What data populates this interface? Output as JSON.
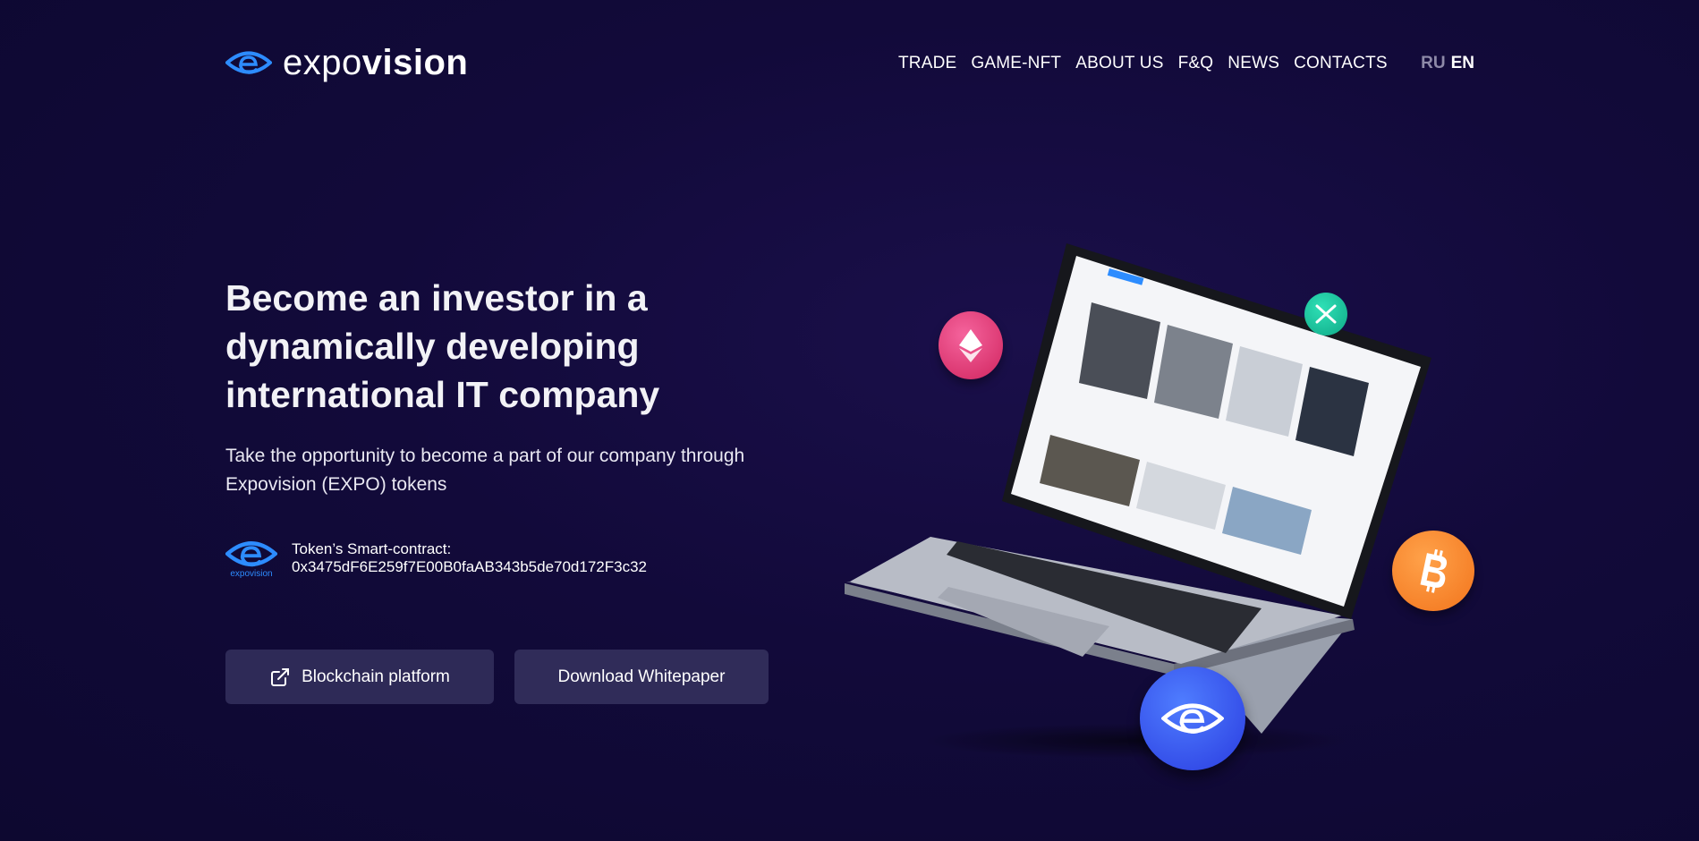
{
  "brand": {
    "name_part1": "expo",
    "name_part2": "vision",
    "small_logo_text": "expovision"
  },
  "nav": {
    "items": [
      {
        "label": "TRADE"
      },
      {
        "label": "GAME-NFT"
      },
      {
        "label": "ABOUT US"
      },
      {
        "label": "F&Q"
      },
      {
        "label": "NEWS"
      },
      {
        "label": "CONTACTS"
      }
    ],
    "lang_ru": "RU",
    "lang_en": "EN"
  },
  "hero": {
    "title": "Become an investor in a dynamically developing international IT company",
    "subtitle": "Take the opportunity to become a part of our company through Expovision (EXPO) tokens",
    "contract_label": "Token’s Smart-contract:",
    "contract_address": "0x3475dF6E259f7E00B0faAB343b5de70d172F3c32"
  },
  "buttons": {
    "blockchain_label": "Blockchain platform",
    "whitepaper_label": "Download Whitepaper"
  },
  "colors": {
    "background": "#120a3a",
    "button": "#2e2a57",
    "brand_blue": "#2d8cff",
    "eth_coin": "#e0336f",
    "xrp_coin": "#1cc79c",
    "btc_coin": "#f7841f",
    "expo_coin": "#3b53f0"
  },
  "icons": {
    "external_link": "external-link-icon",
    "eth": "ethereum-icon",
    "xrp": "xrp-icon",
    "btc": "bitcoin-icon",
    "expo": "expovision-eye-icon"
  }
}
